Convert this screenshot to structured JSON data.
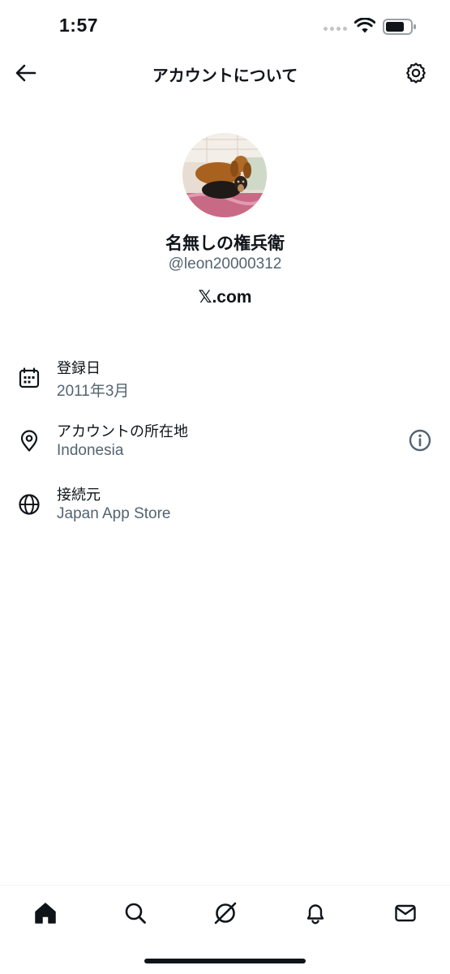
{
  "status_bar": {
    "time": "1:57",
    "icons": [
      "signal-icon",
      "wifi-icon",
      "battery-icon"
    ]
  },
  "nav": {
    "title": "アカウントについて",
    "back_icon": "arrow-left-icon",
    "settings_icon": "gear-icon"
  },
  "profile": {
    "display_name": "名無しの権兵衛",
    "handle": "@leon20000312",
    "site": "𝕏.com",
    "avatar": "dogs-photo-avatar"
  },
  "details": [
    {
      "icon": "calendar-icon",
      "label": "登録日",
      "value": "2011年3月"
    },
    {
      "icon": "location-pin-icon",
      "label": "アカウントの所在地",
      "value": "Indonesia",
      "action_icon": "info-circle-icon"
    },
    {
      "icon": "globe-icon",
      "label": "接続元",
      "value": "Japan App Store"
    }
  ],
  "tabs": [
    {
      "name": "home",
      "icon": "home-icon",
      "active": true
    },
    {
      "name": "search",
      "icon": "search-icon",
      "active": false
    },
    {
      "name": "grok",
      "icon": "grok-icon",
      "active": false
    },
    {
      "name": "notifications",
      "icon": "bell-icon",
      "active": false
    },
    {
      "name": "messages",
      "icon": "mail-icon",
      "active": false
    }
  ],
  "colors": {
    "text": "#0f1419",
    "secondary": "#536471",
    "background": "#ffffff",
    "divider": "#eff3f4"
  }
}
